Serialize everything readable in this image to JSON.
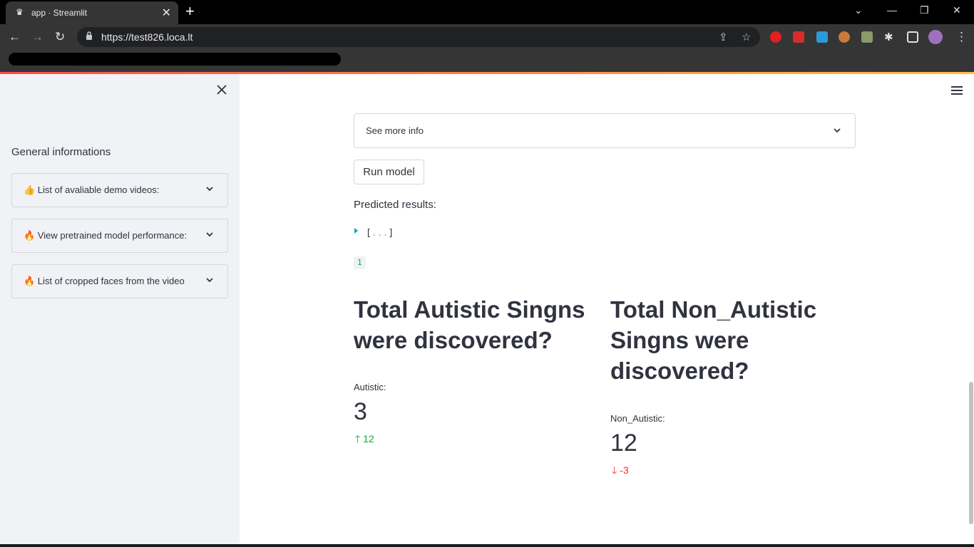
{
  "browser": {
    "tab_title": "app · Streamlit",
    "url": "https://test826.loca.lt"
  },
  "sidebar": {
    "heading": "General informations",
    "expanders": [
      {
        "label": "👍 List of avaliable demo videos:"
      },
      {
        "label": "🔥 View pretrained model performance:"
      },
      {
        "label": "🔥 List of cropped faces from the video"
      }
    ]
  },
  "main": {
    "info_expander": "See more info",
    "run_button": "Run model",
    "predicted_label": "Predicted results:",
    "json_open": "[",
    "json_dots": "...",
    "json_close": "]",
    "code_value": "1",
    "columns": [
      {
        "heading": "Total Autistic Singns were discovered?",
        "metric_label": "Autistic:",
        "metric_value": "3",
        "delta": "12",
        "delta_direction": "up"
      },
      {
        "heading": "Total Non_Autistic Singns were discovered?",
        "metric_label": "Non_Autistic:",
        "metric_value": "12",
        "delta": "-3",
        "delta_direction": "down"
      }
    ]
  },
  "colors": {
    "accent_red": "#ff4b4b",
    "delta_up": "#09ab3b",
    "delta_down": "#ff2b2b",
    "text": "#31333f",
    "sidebar_bg": "#f0f2f6"
  }
}
